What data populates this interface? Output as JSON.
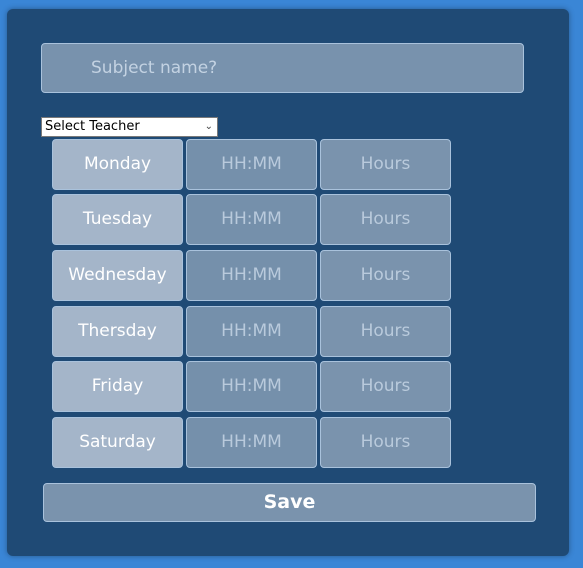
{
  "form": {
    "subject_placeholder": "Subject name?",
    "teacher_select": {
      "selected": "Select Teacher"
    },
    "rows": [
      {
        "day": "Monday",
        "time_placeholder": "HH:MM",
        "hours_placeholder": "Hours"
      },
      {
        "day": "Tuesday",
        "time_placeholder": "HH:MM",
        "hours_placeholder": "Hours"
      },
      {
        "day": "Wednesday",
        "time_placeholder": "HH:MM",
        "hours_placeholder": "Hours"
      },
      {
        "day": "Thersday",
        "time_placeholder": "HH:MM",
        "hours_placeholder": "Hours"
      },
      {
        "day": "Friday",
        "time_placeholder": "HH:MM",
        "hours_placeholder": "Hours"
      },
      {
        "day": "Saturday",
        "time_placeholder": "HH:MM",
        "hours_placeholder": "Hours"
      }
    ],
    "save_label": "Save"
  },
  "colors": {
    "background": "#3a86d6",
    "panel": "#1f4a75",
    "field": "#7a93ad"
  }
}
